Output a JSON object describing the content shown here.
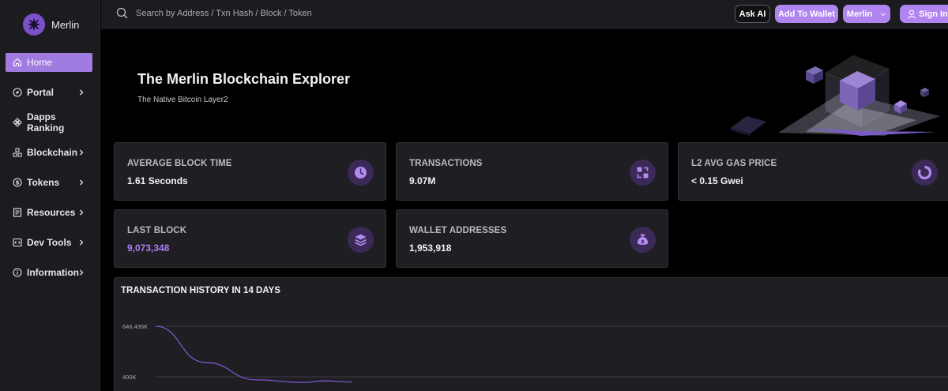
{
  "brand": {
    "name": "Merlin"
  },
  "sidebar": {
    "items": [
      {
        "label": "Home",
        "icon": "home-icon",
        "active": true,
        "chevron": false
      },
      {
        "label": "Portal",
        "icon": "compass-icon",
        "active": false,
        "chevron": true
      },
      {
        "label": "Dapps Ranking",
        "icon": "diamond-grid-icon",
        "active": false,
        "chevron": false
      },
      {
        "label": "Blockchain",
        "icon": "blocks-icon",
        "active": false,
        "chevron": true
      },
      {
        "label": "Tokens",
        "icon": "dollar-coin-icon",
        "active": false,
        "chevron": true
      },
      {
        "label": "Resources",
        "icon": "document-icon",
        "active": false,
        "chevron": true
      },
      {
        "label": "Dev Tools",
        "icon": "code-icon",
        "active": false,
        "chevron": true
      },
      {
        "label": "Information",
        "icon": "info-icon",
        "active": false,
        "chevron": true
      }
    ]
  },
  "header": {
    "search_placeholder": "Search by Address / Txn Hash / Block / Token",
    "ask_ai": "Ask AI",
    "add_wallet": "Add To Wallet",
    "network": "Merlin",
    "sign_in": "Sign In"
  },
  "hero": {
    "title": "The Merlin Blockchain Explorer",
    "subtitle": "The Native Bitcoin Layer2"
  },
  "stats": {
    "avg_block_time": {
      "label": "AVERAGE BLOCK TIME",
      "value": "1.61 Seconds"
    },
    "transactions": {
      "label": "TRANSACTIONS",
      "value": "9.07M"
    },
    "gas_price": {
      "label": "L2 AVG GAS PRICE",
      "value": "< 0.15 Gwei"
    },
    "last_block": {
      "label": "LAST BLOCK",
      "value": "9,073,348"
    },
    "wallet_addresses": {
      "label": "WALLET ADDRESSES",
      "value": "1,953,918"
    }
  },
  "chart": {
    "title": "TRANSACTION HISTORY IN 14 DAYS"
  },
  "chart_data": {
    "type": "line",
    "title": "TRANSACTION HISTORY IN 14 DAYS",
    "y_ticks": [
      "646.436K",
      "400K"
    ],
    "y_tick_values": [
      646436,
      400000
    ],
    "series": [
      {
        "values": [
          646436,
          470000,
          385000,
          372000,
          380000,
          375000
        ]
      }
    ],
    "grid": true,
    "colors": {
      "line": "#7b55c8"
    }
  },
  "colors": {
    "accent": "#b185f0",
    "active_nav": "#a07be0",
    "card_bg": "#1f1f23",
    "icon_bg": "#3b2a57"
  }
}
